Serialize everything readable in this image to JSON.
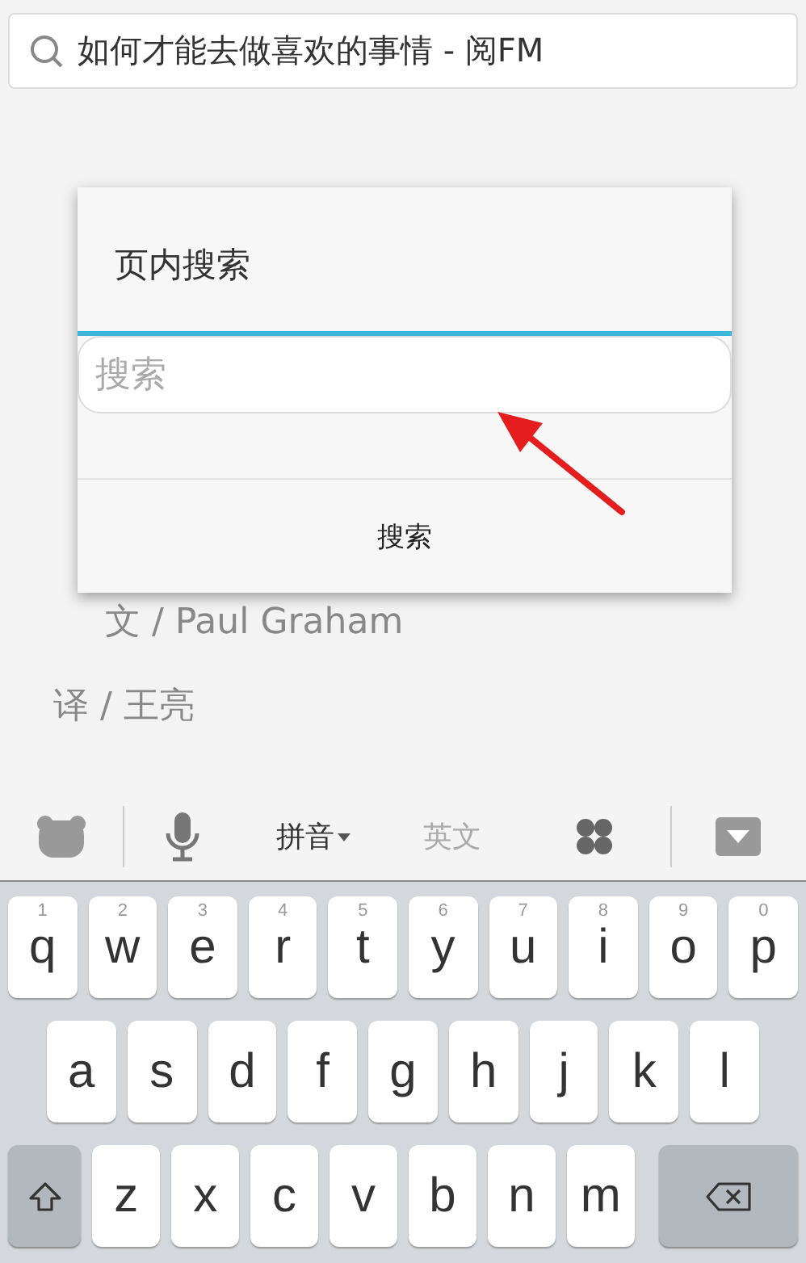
{
  "address_bar": {
    "value": "如何才能去做喜欢的事情 - 阅FM"
  },
  "article": {
    "author": "文 / Paul Graham",
    "translator": "译 / 王亮"
  },
  "dialog": {
    "title": "页内搜索",
    "search": {
      "placeholder": "搜索"
    },
    "button": "搜索"
  },
  "keyboard": {
    "modes": [
      {
        "label": "拼音",
        "selected": true
      },
      {
        "label": "英文",
        "selected": false
      }
    ],
    "rows": [
      [
        {
          "letter": "q",
          "hint": "1"
        },
        {
          "letter": "w",
          "hint": "2"
        },
        {
          "letter": "e",
          "hint": "3"
        },
        {
          "letter": "r",
          "hint": "4"
        },
        {
          "letter": "t",
          "hint": "5"
        },
        {
          "letter": "y",
          "hint": "6"
        },
        {
          "letter": "u",
          "hint": "7"
        },
        {
          "letter": "i",
          "hint": "8"
        },
        {
          "letter": "o",
          "hint": "9"
        },
        {
          "letter": "p",
          "hint": "0"
        }
      ],
      [
        {
          "letter": "a"
        },
        {
          "letter": "s"
        },
        {
          "letter": "d"
        },
        {
          "letter": "f"
        },
        {
          "letter": "g"
        },
        {
          "letter": "h"
        },
        {
          "letter": "j"
        },
        {
          "letter": "k"
        },
        {
          "letter": "l"
        }
      ],
      [
        {
          "letter": "z"
        },
        {
          "letter": "x"
        },
        {
          "letter": "c"
        },
        {
          "letter": "v"
        },
        {
          "letter": "b"
        },
        {
          "letter": "n"
        },
        {
          "letter": "m"
        }
      ]
    ]
  }
}
